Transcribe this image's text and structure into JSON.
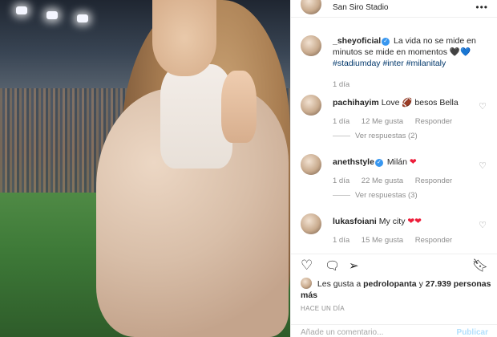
{
  "post": {
    "location": "San Siro Stadio",
    "caption": {
      "username": "_sheyoficial",
      "text": "La vida no se mide en minutos se mide en momentos",
      "emojis": "🖤💙",
      "tags": "#stadiumday #inter #milanitaly",
      "time": "1 día"
    }
  },
  "comments": [
    {
      "username": "pachihayim",
      "text": "Love",
      "emoji": "🏈",
      "text2": "besos Bella",
      "time": "1 día",
      "likes": "12 Me gusta",
      "reply": "Responder",
      "view_replies": "Ver respuestas (2)"
    },
    {
      "username": "anethstyle",
      "verified": true,
      "text": "Milán",
      "emoji": "❤",
      "time": "1 día",
      "likes": "22 Me gusta",
      "reply": "Responder",
      "view_replies": "Ver respuestas (3)"
    },
    {
      "username": "lukasfoiani",
      "text": "My city",
      "emoji": "❤❤",
      "time": "1 día",
      "likes": "15 Me gusta",
      "reply": "Responder"
    }
  ],
  "likes_line": {
    "prefix": "Les gusta a",
    "user": "pedrolopanta",
    "conj": "y",
    "count": "27.939 personas más"
  },
  "time_ago": "HACE UN DÍA",
  "add_comment": {
    "placeholder": "Añade un comentario...",
    "publish": "Publicar"
  },
  "icons": {
    "more": "more-options-icon",
    "like": "heart-icon",
    "comment": "comment-icon",
    "share": "share-icon",
    "save": "bookmark-icon"
  },
  "colors": {
    "link": "#00376b",
    "verified": "#3897f0",
    "red_heart": "#ed1d3a",
    "muted": "#8e8e8e"
  }
}
